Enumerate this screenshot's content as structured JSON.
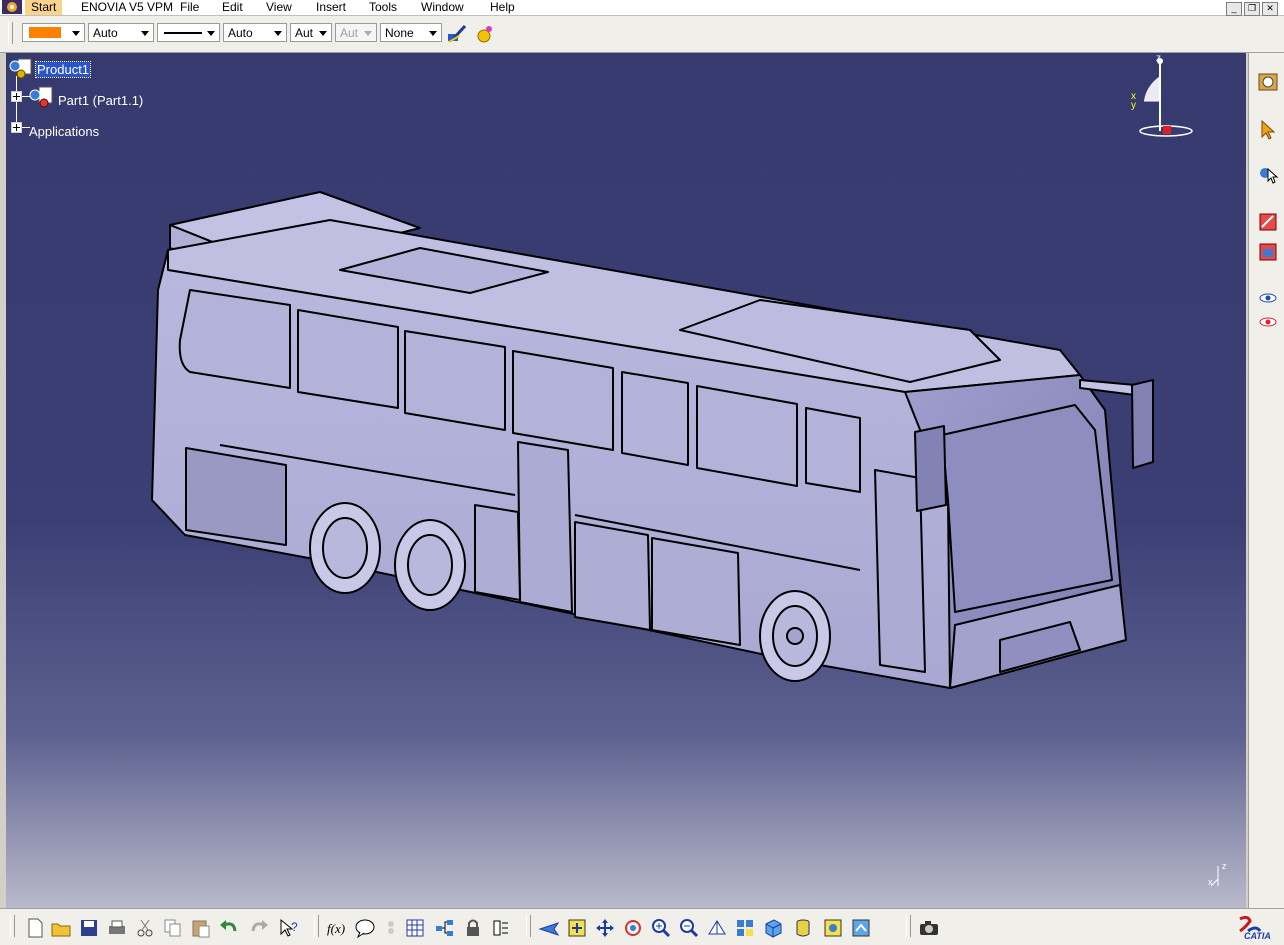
{
  "menubar": {
    "start": "Start",
    "enovia": "ENOVIA V5 VPM",
    "file": "File",
    "edit": "Edit",
    "view": "View",
    "insert": "Insert",
    "tools": "Tools",
    "window": "Window",
    "help": "Help"
  },
  "properties": {
    "fill_color": "#ff8000",
    "transparency": "Auto",
    "thickness": "Auto",
    "line_type_short": "Aut",
    "point_type_short": "Aut",
    "layer": "None"
  },
  "tree": {
    "root": "Product1",
    "part": "Part1 (Part1.1)",
    "applications": "Applications"
  },
  "compass": {
    "x": "x",
    "y": "y",
    "z": "z"
  },
  "bottom_toolbar": {
    "icons": [
      "new-icon",
      "open-icon",
      "save-icon",
      "print-icon",
      "cut-icon",
      "copy-icon",
      "paste-icon",
      "undo-icon",
      "redo-icon",
      "whats-this-icon",
      "formula-icon",
      "comment-icon",
      "knowledge-icon",
      "table-icon",
      "tree-icon",
      "lock-icon",
      "catalog-icon",
      "fly-mode-icon",
      "fit-all-icon",
      "pan-icon",
      "rotate-icon",
      "zoom-in-icon",
      "zoom-out-icon",
      "normal-view-icon",
      "multi-view-icon",
      "iso-view-icon",
      "shading-icon",
      "hide-show-icon",
      "swap-visible-icon",
      "capture-icon"
    ]
  },
  "right_toolbar": {
    "icons": [
      "workbench-icon",
      "select-icon",
      "snap-icon",
      "product-icon",
      "render-icon",
      "sight-icon",
      "sight-alt-icon"
    ]
  },
  "brand": "CATIA"
}
